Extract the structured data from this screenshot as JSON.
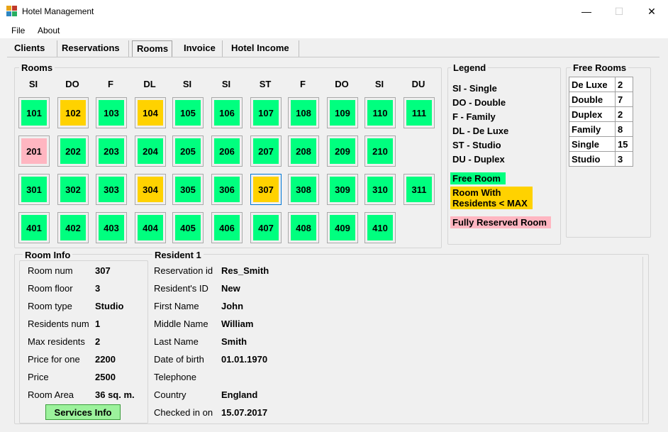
{
  "window": {
    "title": "Hotel Management",
    "minimize": "—",
    "maximize": "☐",
    "close": "✕"
  },
  "menu": {
    "file": "File",
    "about": "About"
  },
  "tabs": [
    "Clients",
    "Reservations",
    "Rooms",
    "Invoice",
    "Hotel Income"
  ],
  "active_tab": "Rooms",
  "colors": {
    "free": "#00ff7f",
    "partial": "#ffd200",
    "full": "#ffb6c1",
    "accent": "#0078d7"
  },
  "rooms": {
    "title": "Rooms",
    "types": [
      "SI",
      "DO",
      "F",
      "DL",
      "SI",
      "SI",
      "ST",
      "F",
      "DO",
      "SI",
      "DU"
    ],
    "rows": [
      [
        {
          "num": "101",
          "status": "free"
        },
        {
          "num": "102",
          "status": "partial"
        },
        {
          "num": "103",
          "status": "free"
        },
        {
          "num": "104",
          "status": "partial"
        },
        {
          "num": "105",
          "status": "free"
        },
        {
          "num": "106",
          "status": "free"
        },
        {
          "num": "107",
          "status": "free"
        },
        {
          "num": "108",
          "status": "free"
        },
        {
          "num": "109",
          "status": "free"
        },
        {
          "num": "110",
          "status": "free"
        },
        {
          "num": "111",
          "status": "free"
        }
      ],
      [
        {
          "num": "201",
          "status": "full"
        },
        {
          "num": "202",
          "status": "free"
        },
        {
          "num": "203",
          "status": "free"
        },
        {
          "num": "204",
          "status": "free"
        },
        {
          "num": "205",
          "status": "free"
        },
        {
          "num": "206",
          "status": "free"
        },
        {
          "num": "207",
          "status": "free"
        },
        {
          "num": "208",
          "status": "free"
        },
        {
          "num": "209",
          "status": "free"
        },
        {
          "num": "210",
          "status": "free"
        }
      ],
      [
        {
          "num": "301",
          "status": "free"
        },
        {
          "num": "302",
          "status": "free"
        },
        {
          "num": "303",
          "status": "free"
        },
        {
          "num": "304",
          "status": "partial"
        },
        {
          "num": "305",
          "status": "free"
        },
        {
          "num": "306",
          "status": "free"
        },
        {
          "num": "307",
          "status": "partial",
          "selected": true
        },
        {
          "num": "308",
          "status": "free"
        },
        {
          "num": "309",
          "status": "free"
        },
        {
          "num": "310",
          "status": "free"
        },
        {
          "num": "311",
          "status": "free"
        }
      ],
      [
        {
          "num": "401",
          "status": "free"
        },
        {
          "num": "402",
          "status": "free"
        },
        {
          "num": "403",
          "status": "free"
        },
        {
          "num": "404",
          "status": "free"
        },
        {
          "num": "405",
          "status": "free"
        },
        {
          "num": "406",
          "status": "free"
        },
        {
          "num": "407",
          "status": "free"
        },
        {
          "num": "408",
          "status": "free"
        },
        {
          "num": "409",
          "status": "free"
        },
        {
          "num": "410",
          "status": "free"
        }
      ]
    ]
  },
  "legend": {
    "title": "Legend",
    "items": [
      "SI - Single",
      "DO - Double",
      "F - Family",
      "DL - De Luxe",
      "ST - Studio",
      "DU - Duplex"
    ],
    "free_label": "Free Room",
    "partial_label_1": "Room With",
    "partial_label_2": "Residents < MAX",
    "full_label": "Fully Reserved Room"
  },
  "free_rooms": {
    "title": "Free Rooms",
    "rows": [
      {
        "type": "De Luxe",
        "count": "2"
      },
      {
        "type": "Double",
        "count": "7"
      },
      {
        "type": "Duplex",
        "count": "2"
      },
      {
        "type": "Family",
        "count": "8"
      },
      {
        "type": "Single",
        "count": "15"
      },
      {
        "type": "Studio",
        "count": "3"
      }
    ]
  },
  "room_info": {
    "title": "Room Info",
    "fields": [
      {
        "label": "Room num",
        "value": "307"
      },
      {
        "label": "Room floor",
        "value": "3"
      },
      {
        "label": "Room type",
        "value": "Studio"
      },
      {
        "label": "Residents num",
        "value": "1"
      },
      {
        "label": "Max residents",
        "value": "2"
      },
      {
        "label": "Price for one",
        "value": "2200"
      },
      {
        "label": "Price",
        "value": "2500"
      },
      {
        "label": "Room Area",
        "value": "36 sq. m."
      }
    ],
    "services_button": "Services Info"
  },
  "resident": {
    "title": "Resident 1",
    "fields": [
      {
        "label": "Reservation id",
        "value": "Res_Smith"
      },
      {
        "label": "Resident's ID",
        "value": "New"
      },
      {
        "label": "First Name",
        "value": "John"
      },
      {
        "label": "Middle Name",
        "value": "William"
      },
      {
        "label": "Last Name",
        "value": "Smith"
      },
      {
        "label": "Date of birth",
        "value": "01.01.1970"
      },
      {
        "label": "Telephone",
        "value": ""
      },
      {
        "label": "Country",
        "value": "England"
      },
      {
        "label": "Checked in on",
        "value": "15.07.2017"
      }
    ]
  }
}
